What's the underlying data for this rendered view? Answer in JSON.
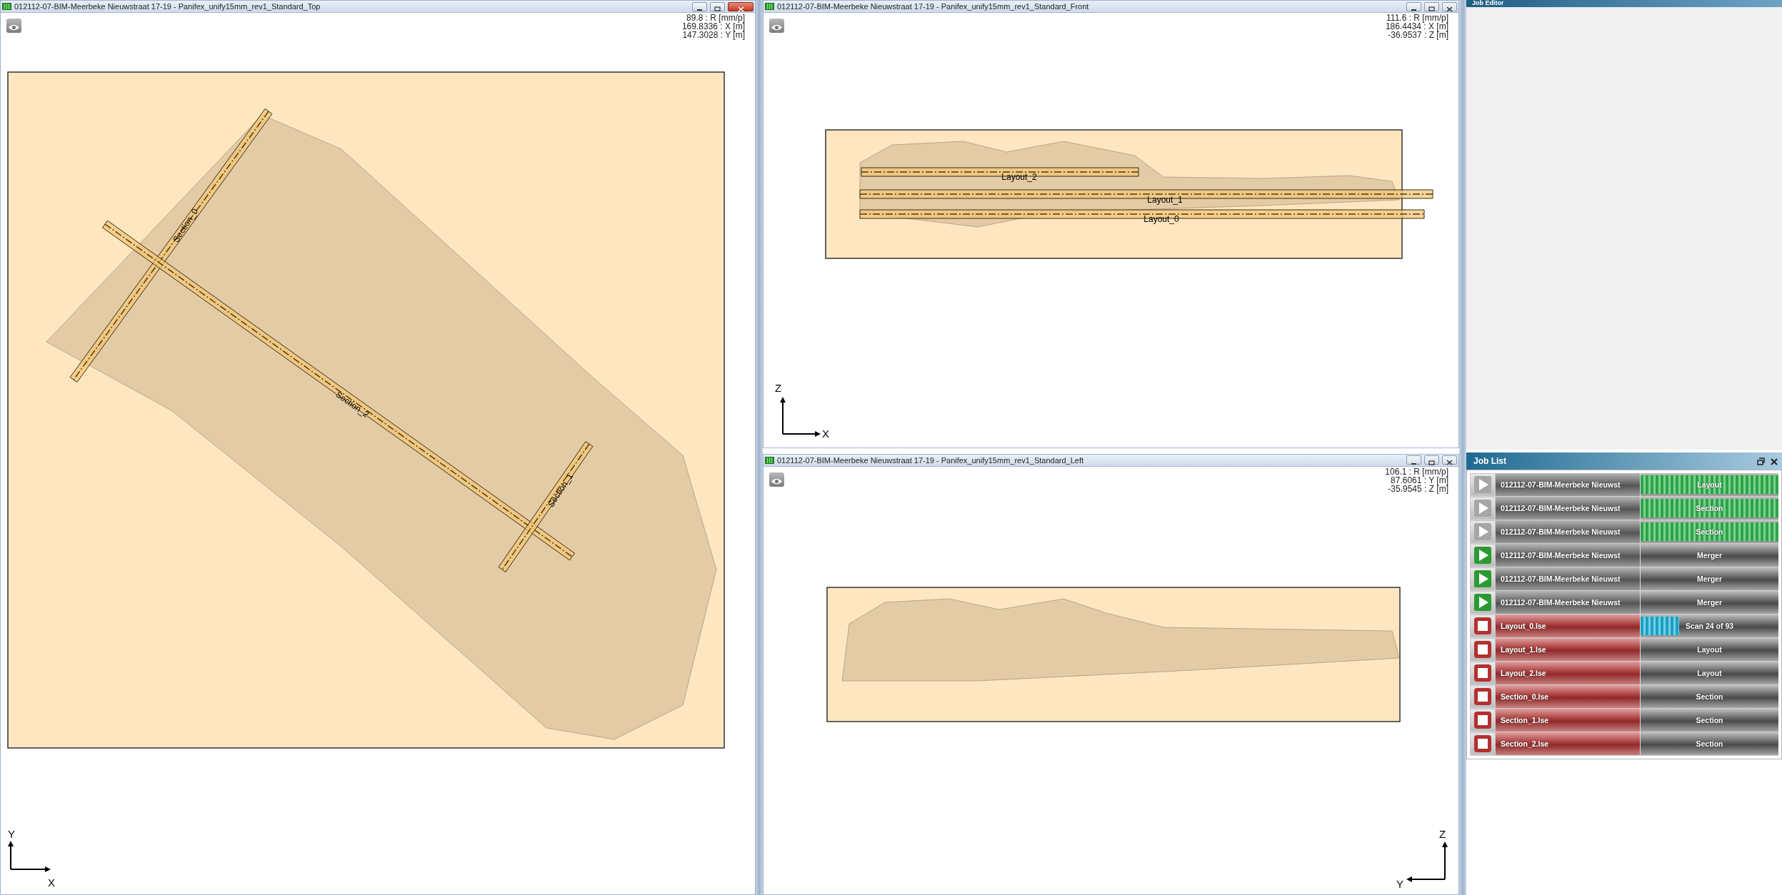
{
  "views": [
    {
      "kind": "top",
      "active": true,
      "title": "012112-07-BIM-Meerbeke Nieuwstraat 17-19 - Panifex_unify15mm_rev1_Standard_Top",
      "readings": [
        "89.8 : R [mm/p]",
        "169.8336 : X [m]",
        "147.3028 : Y [m]"
      ],
      "axes": {
        "vertical": "Y",
        "horizontal": "X"
      },
      "markers": [
        {
          "label": "Section_0"
        },
        {
          "label": "Section_2"
        },
        {
          "label": "Section_1"
        }
      ]
    },
    {
      "kind": "front",
      "active": false,
      "title": "012112-07-BIM-Meerbeke Nieuwstraat 17-19 - Panifex_unify15mm_rev1_Standard_Front",
      "readings": [
        "111.6 : R [mm/p]",
        "186.4434 : X [m]",
        "-36.9537 : Z [m]"
      ],
      "axes": {
        "vertical": "Z",
        "horizontal": "X"
      },
      "markers": [
        {
          "label": "Layout_2"
        },
        {
          "label": "Layout_1"
        },
        {
          "label": "Layout_0"
        }
      ]
    },
    {
      "kind": "left",
      "active": false,
      "title": "012112-07-BIM-Meerbeke Nieuwstraat 17-19 - Panifex_unify15mm_rev1_Standard_Left",
      "readings": [
        "106.1 : R [mm/p]",
        "87.6061 : Y [m]",
        "-35.9545 : Z [m]"
      ],
      "axes": {
        "vertical": "Z",
        "horizontal": "Y"
      }
    }
  ],
  "job_editor": {
    "title": "Job Editor"
  },
  "job_list": {
    "title": "Job List",
    "jobs": [
      {
        "kind": "done",
        "name": "012112-07-BIM-Meerbeke Nieuwst",
        "task": "Layout",
        "level": 1
      },
      {
        "kind": "done",
        "name": "012112-07-BIM-Meerbeke Nieuwst",
        "task": "Section",
        "level": 1
      },
      {
        "kind": "done",
        "name": "012112-07-BIM-Meerbeke Nieuwst",
        "task": "Section",
        "level": 1
      },
      {
        "kind": "ready",
        "name": "012112-07-BIM-Meerbeke Nieuwst",
        "task": "Merger"
      },
      {
        "kind": "ready",
        "name": "012112-07-BIM-Meerbeke Nieuwst",
        "task": "Merger"
      },
      {
        "kind": "ready",
        "name": "012112-07-BIM-Meerbeke Nieuwst",
        "task": "Merger"
      },
      {
        "kind": "running",
        "name": "Layout_0.lse",
        "task": "Scan 24 of 93",
        "level": 0.28
      },
      {
        "kind": "queued",
        "name": "Layout_1.lse",
        "task": "Layout"
      },
      {
        "kind": "queued",
        "name": "Layout_2.lse",
        "task": "Layout"
      },
      {
        "kind": "queued",
        "name": "Section_0.lse",
        "task": "Section"
      },
      {
        "kind": "queued",
        "name": "Section_1.lse",
        "task": "Section"
      },
      {
        "kind": "queued",
        "name": "Section_2.lse",
        "task": "Section"
      }
    ]
  }
}
